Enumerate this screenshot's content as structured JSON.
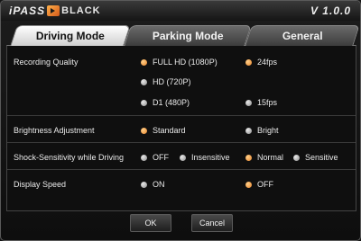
{
  "app": {
    "brand_prefix": "iPASS",
    "brand_suffix": "BLACK",
    "version": "V 1.0.0"
  },
  "tabs": [
    {
      "label": "Driving Mode",
      "active": true
    },
    {
      "label": "Parking Mode",
      "active": false
    },
    {
      "label": "General",
      "active": false
    }
  ],
  "settings": {
    "recording_quality": {
      "label": "Recording Quality",
      "resolutions": [
        {
          "label": "FULL HD (1080P)",
          "selected": true
        },
        {
          "label": "HD (720P)",
          "selected": false
        },
        {
          "label": "D1 (480P)",
          "selected": false
        }
      ],
      "frame_rates": [
        {
          "label": "24fps",
          "selected": true
        },
        {
          "label": "15fps",
          "selected": false
        }
      ]
    },
    "brightness": {
      "label": "Brightness Adjustment",
      "options": [
        {
          "label": "Standard",
          "selected": true
        },
        {
          "label": "Bright",
          "selected": false
        }
      ]
    },
    "shock_sensitivity": {
      "label": "Shock-Sensitivity while Driving",
      "options": [
        {
          "label": "OFF",
          "selected": false
        },
        {
          "label": "Insensitive",
          "selected": false
        },
        {
          "label": "Normal",
          "selected": true
        },
        {
          "label": "Sensitive",
          "selected": false
        }
      ]
    },
    "display_speed": {
      "label": "Display Speed",
      "options": [
        {
          "label": "ON",
          "selected": false
        },
        {
          "label": "OFF",
          "selected": true
        }
      ]
    }
  },
  "buttons": {
    "ok": "OK",
    "cancel": "Cancel"
  },
  "colors": {
    "accent_selected": "#e8842a",
    "radio_unselected": "#9a9a9a",
    "tab_active": "#e6e6e6"
  }
}
